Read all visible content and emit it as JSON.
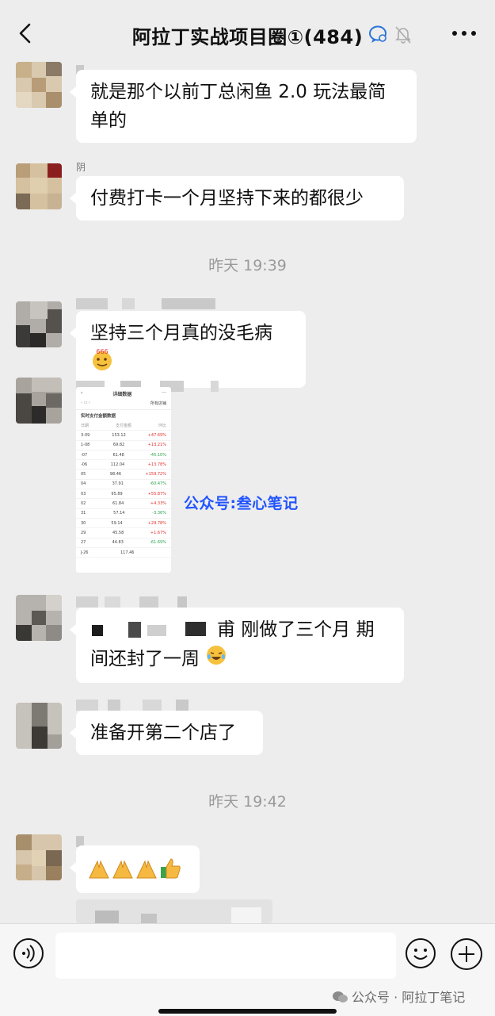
{
  "header": {
    "title": "阿拉丁实战项目圈①(484)",
    "back_icon": "chevron-left-icon",
    "more_icon": "more-dots-icon"
  },
  "messages": [
    {
      "nickname": "",
      "text": "就是那个以前丁总闲鱼 2.0 玩法最简单的"
    },
    {
      "nickname": "阴",
      "text": "付费打卡一个月坚持下来的都很少"
    },
    {
      "nickname": "",
      "text": "坚持三个月真的没毛病"
    },
    {
      "nickname": "",
      "text": ""
    },
    {
      "nickname": "",
      "text": "甫 刚做了三个月  期间还封了一周"
    },
    {
      "nickname": "",
      "text": "准备开第二个店了"
    },
    {
      "nickname": "",
      "text": ""
    }
  ],
  "timestamps": [
    "昨天 19:39",
    "昨天 19:42"
  ],
  "shared_image": {
    "title": "详细数据",
    "tab": "所有店铺",
    "section": "实时支付金额数据",
    "col_headers": [
      "日期",
      "支付金额",
      "环比"
    ],
    "rows": [
      [
        "3-09",
        "153.12",
        "+47.69%"
      ],
      [
        "1-08",
        "69.82",
        "+13.21%"
      ],
      [
        "-07",
        "61.48",
        "-45.10%"
      ],
      [
        "-06",
        "112.04",
        "+13.78%"
      ],
      [
        "05",
        "98.46",
        "+159.72%"
      ],
      [
        "04",
        "37.91",
        "-60.47%"
      ],
      [
        "03",
        "95.89",
        "+55.87%"
      ],
      [
        "02",
        "61.84",
        "+4.33%"
      ],
      [
        "31",
        "57.14",
        "-3.36%"
      ],
      [
        "30",
        "59.14",
        "+29.78%"
      ],
      [
        "29",
        "45.58",
        "+1.67%"
      ],
      [
        "27",
        "44.83",
        "-61.69%"
      ],
      [
        "J-26",
        "117.46",
        ""
      ]
    ]
  },
  "watermark": "公众号:叁心笔记",
  "input": {
    "value": "",
    "placeholder": ""
  },
  "footer_watermark": "公众号 · 阿拉丁笔记",
  "colors": {
    "background": "#ededed",
    "bubble": "#ffffff",
    "timestamp": "#9a9a9a",
    "watermark": "#2255ff"
  }
}
